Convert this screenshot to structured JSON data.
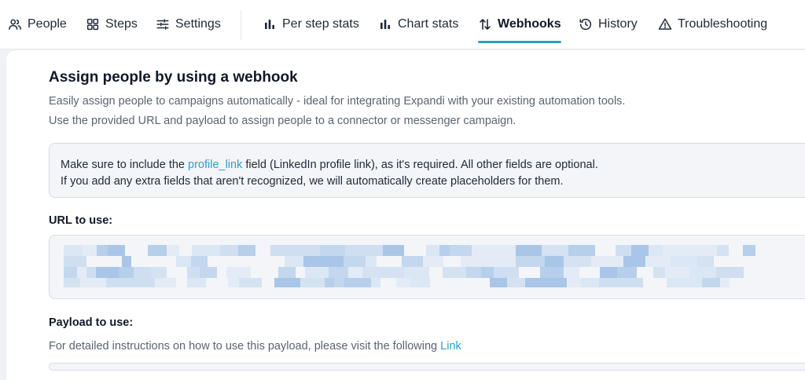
{
  "tabs": [
    {
      "label": "People",
      "icon": "people-icon"
    },
    {
      "label": "Steps",
      "icon": "steps-icon"
    },
    {
      "label": "Settings",
      "icon": "settings-icon"
    },
    {
      "label": "Per step stats",
      "icon": "bar-chart-icon"
    },
    {
      "label": "Chart stats",
      "icon": "bar-chart-icon"
    },
    {
      "label": "Webhooks",
      "icon": "webhook-arrows-icon",
      "active": true
    },
    {
      "label": "History",
      "icon": "history-icon"
    },
    {
      "label": "Troubleshooting",
      "icon": "warning-icon"
    }
  ],
  "page": {
    "title": "Assign people by using a webhook",
    "description_1": "Easily assign people to campaigns automatically - ideal for integrating Expandi with your existing automation tools.",
    "description_2": "Use the provided URL and payload to assign people to a connector or messenger campaign."
  },
  "notice": {
    "line1_before": "Make sure to include the ",
    "line1_link": "profile_link",
    "line1_after": " field (LinkedIn profile link), as it's required. All other fields are optional.",
    "line2": "If you add any extra fields that aren't recognized, we will automatically create placeholders for them."
  },
  "url_section": {
    "label": "URL to use:"
  },
  "payload_section": {
    "label": "Payload to use:",
    "help_before": "For detailed instructions on how to use this payload, please visit the following ",
    "help_link": "Link"
  },
  "colors": {
    "accent": "#2aa1c9",
    "notice_bg": "#f3f5f8",
    "border": "#d7dce2"
  }
}
